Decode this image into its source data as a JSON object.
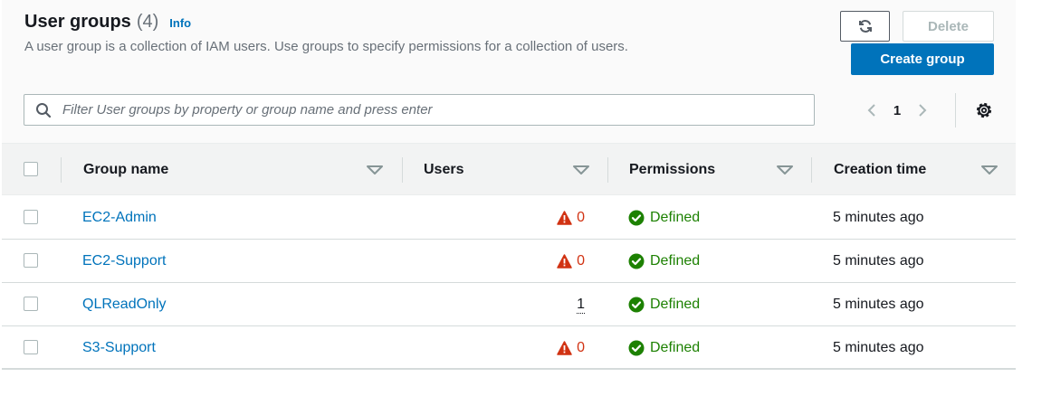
{
  "header": {
    "title": "User groups",
    "count": "(4)",
    "info_label": "Info",
    "description": "A user group is a collection of IAM users. Use groups to specify permissions for a collection of users."
  },
  "actions": {
    "refresh_icon": "refresh-icon",
    "delete_label": "Delete",
    "create_label": "Create group"
  },
  "search": {
    "placeholder": "Filter User groups by property or group name and press enter",
    "value": ""
  },
  "pagination": {
    "current_page": "1"
  },
  "table": {
    "columns": [
      "Group name",
      "Users",
      "Permissions",
      "Creation time"
    ],
    "rows": [
      {
        "name": "EC2-Admin",
        "users": "0",
        "users_warning": true,
        "permissions": "Defined",
        "created": "5 minutes ago"
      },
      {
        "name": "EC2-Support",
        "users": "0",
        "users_warning": true,
        "permissions": "Defined",
        "created": "5 minutes ago"
      },
      {
        "name": "QLReadOnly",
        "users": "1",
        "users_warning": false,
        "permissions": "Defined",
        "created": "5 minutes ago"
      },
      {
        "name": "S3-Support",
        "users": "0",
        "users_warning": true,
        "permissions": "Defined",
        "created": "5 minutes ago"
      }
    ]
  },
  "colors": {
    "link": "#0073bb",
    "primary_button": "#0073bb",
    "warning": "#d13212",
    "success": "#1d8102",
    "header_bg": "#fafafa",
    "table_header_bg": "#f2f3f3"
  }
}
